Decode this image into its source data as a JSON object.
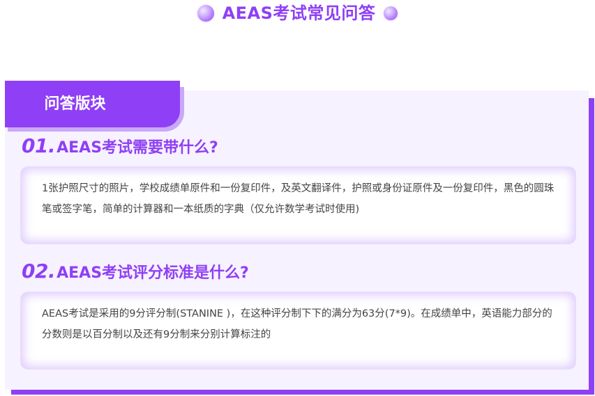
{
  "header": {
    "title": "AEAS考试常见问答"
  },
  "section": {
    "tag_label": "问答版块"
  },
  "qa": [
    {
      "number": "01.",
      "question": "AEAS考试需要带什么?",
      "answer": "1张护照尺寸的照片，学校成绩单原件和一份复印件，及英文翻译件，护照或身份证原件及一份复印件，黑色的圆珠笔或签字笔，简单的计算器和一本纸质的字典（仅允许数学考试时使用)"
    },
    {
      "number": "02.",
      "question": "AEAS考试评分标准是什么?",
      "answer": "AEAS考试是采用的9分评分制(STANINE )，在这种评分制下下的满分为63分(7*9)。在成绩单中，英语能力部分的分数则是以百分制以及还有9分制来分别计算标注的"
    }
  ],
  "colors": {
    "accent": "#8f3ff5",
    "card_background": "#f7f2ff",
    "tag_shadow": "#c9a8fa",
    "answer_text": "#444444"
  }
}
